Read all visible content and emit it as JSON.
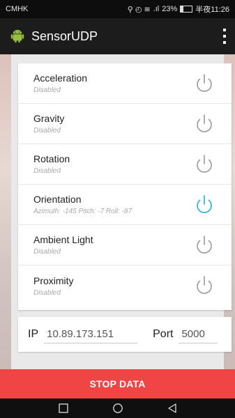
{
  "status_bar": {
    "carrier": "CMHK",
    "indicators": "®ʚ ★ .…",
    "signal_icons": "İ°ı°",
    "battery": "23%",
    "time": "半夜11:26"
  },
  "app": {
    "title": "SensorUDP",
    "accent_color": "#1f1f1f"
  },
  "sensors": [
    {
      "name": "Acceleration",
      "status": "Disabled",
      "enabled": false
    },
    {
      "name": "Gravity",
      "status": "Disabled",
      "enabled": false
    },
    {
      "name": "Rotation",
      "status": "Disabled",
      "enabled": false
    },
    {
      "name": "Orientation",
      "status": "Azimuth: -145 Pitch: -7 Roll: -87",
      "enabled": true
    },
    {
      "name": "Ambient Light",
      "status": "Disabled",
      "enabled": false
    },
    {
      "name": "Proximity",
      "status": "Disabled",
      "enabled": false
    }
  ],
  "network": {
    "ip_label": "IP",
    "ip_value": "10.89.173.151",
    "port_label": "Port",
    "port_value": "5000"
  },
  "stop_button": {
    "label": "STOP DATA",
    "color": "#f14444"
  },
  "colors": {
    "power_on": "#35b6d8",
    "power_off": "#9a9a9a"
  }
}
